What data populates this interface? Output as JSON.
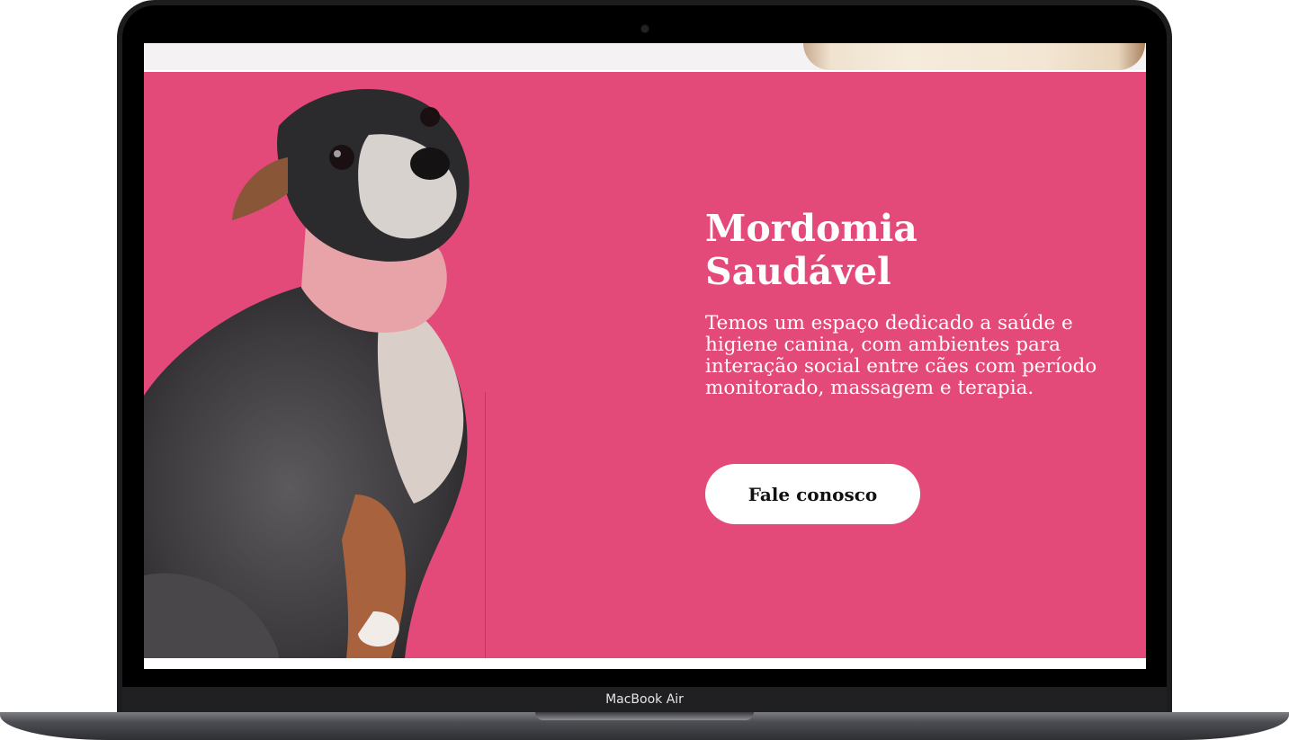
{
  "device": {
    "label": "MacBook Air"
  },
  "hero": {
    "title_line1": "Mordomia",
    "title_line2": "Saudável",
    "description": "Temos um espaço dedicado a saúde e higiene canina, com ambientes para interação social entre cães com período monitorado, massagem e terapia.",
    "cta_label": "Fale conosco",
    "background_color": "#e34a79",
    "image": "chihuahua-dog-photo"
  }
}
